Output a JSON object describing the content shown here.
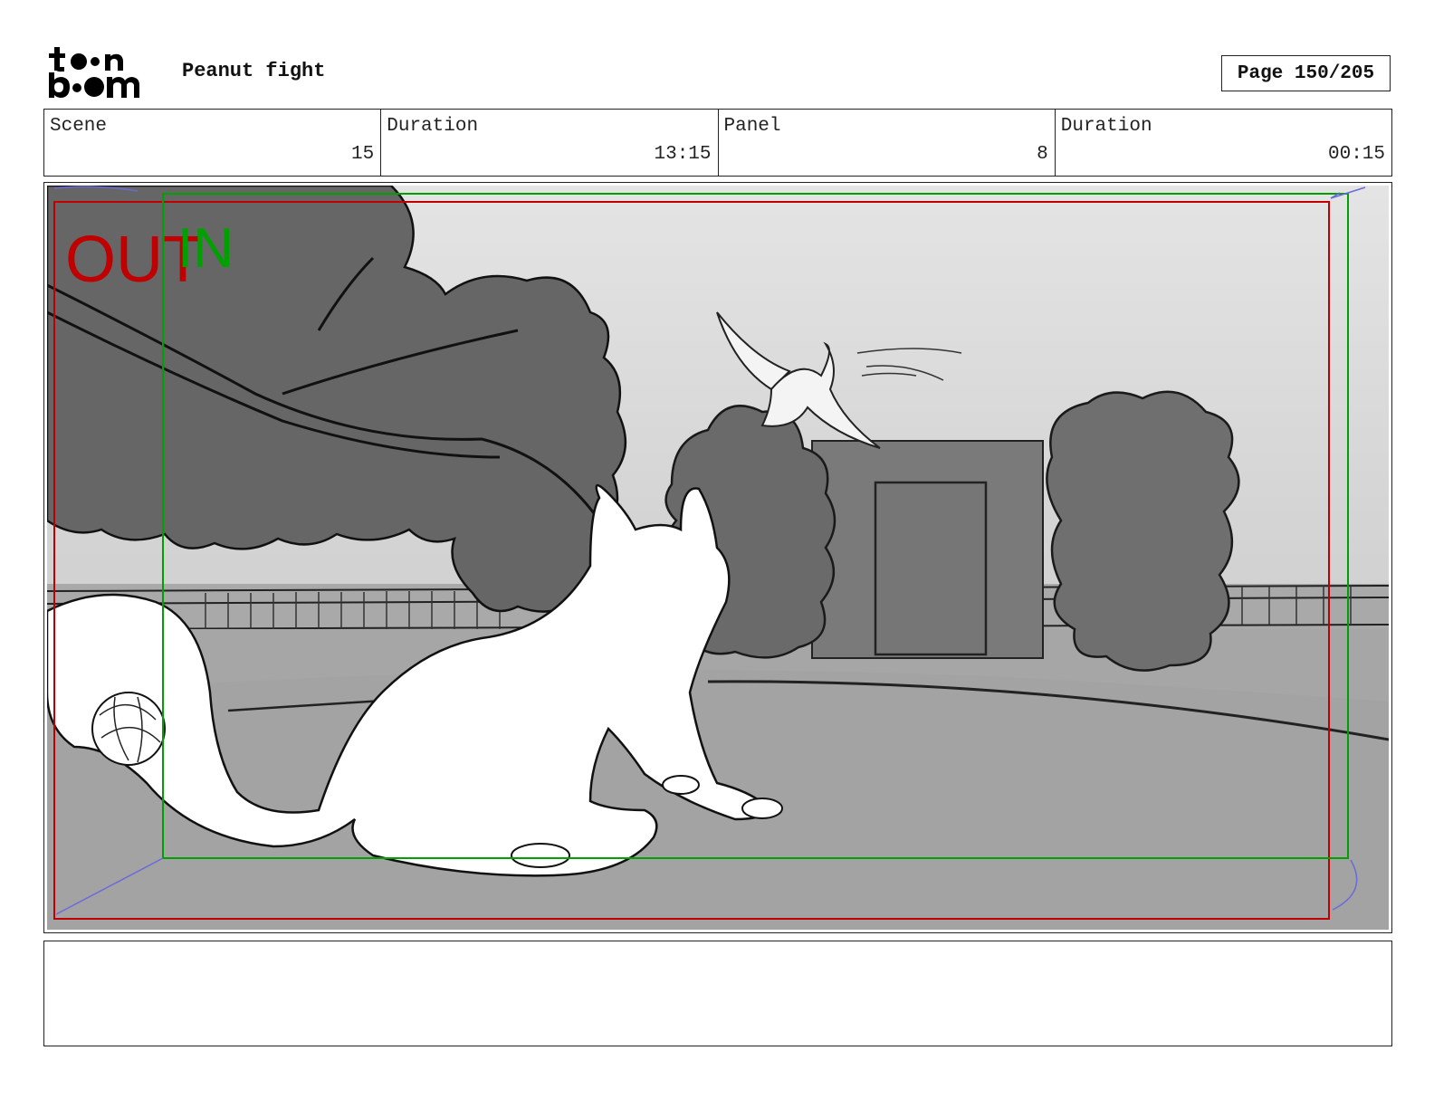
{
  "header": {
    "logo_line1": "toon",
    "logo_line2": "boom",
    "project_title": "Peanut fight",
    "page_label": "Page 150/205"
  },
  "info": [
    {
      "label": "Scene",
      "value": "15"
    },
    {
      "label": "Duration",
      "value": "13:15"
    },
    {
      "label": "Panel",
      "value": "8"
    },
    {
      "label": "Duration",
      "value": "00:15"
    }
  ],
  "frame": {
    "out_label": "OUT",
    "in_label": "IN",
    "out_color": "#c00000",
    "in_color": "#00a000"
  },
  "notes": {
    "text": ""
  }
}
